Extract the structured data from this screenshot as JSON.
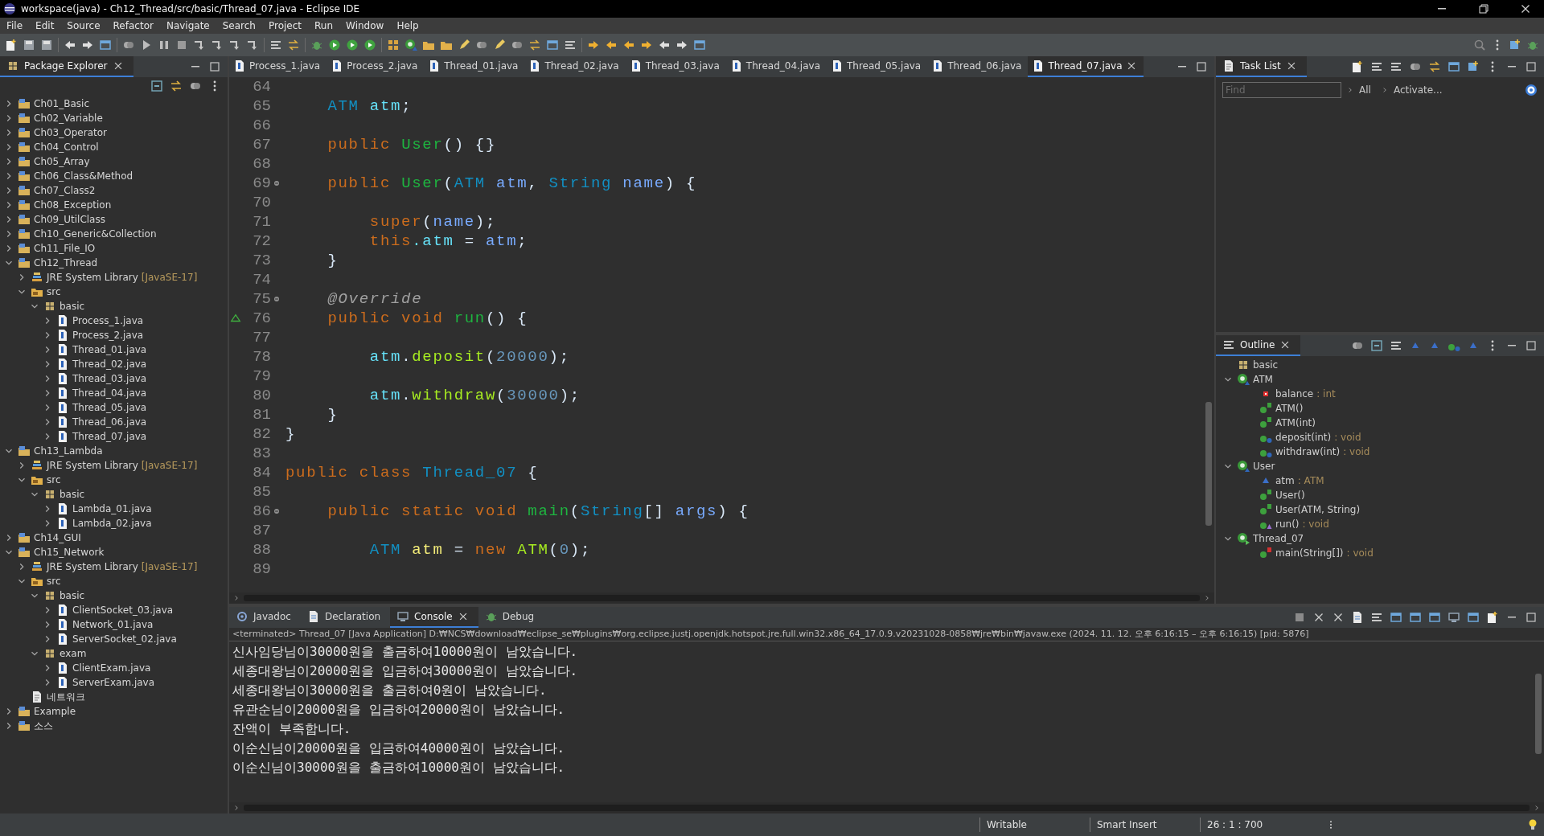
{
  "window": {
    "title": "workspace(java) - Ch12_Thread/src/basic/Thread_07.java - Eclipse IDE"
  },
  "menu": [
    "File",
    "Edit",
    "Source",
    "Refactor",
    "Navigate",
    "Search",
    "Project",
    "Run",
    "Window",
    "Help"
  ],
  "package_explorer": {
    "title": "Package Explorer",
    "tree": [
      {
        "label": "Ch01_Basic",
        "kind": "project",
        "expanded": false
      },
      {
        "label": "Ch02_Variable",
        "kind": "project",
        "expanded": false
      },
      {
        "label": "Ch03_Operator",
        "kind": "project",
        "expanded": false
      },
      {
        "label": "Ch04_Control",
        "kind": "project",
        "expanded": false
      },
      {
        "label": "Ch05_Array",
        "kind": "project",
        "expanded": false
      },
      {
        "label": "Ch06_Class&Method",
        "kind": "project",
        "expanded": false
      },
      {
        "label": "Ch07_Class2",
        "kind": "project",
        "expanded": false
      },
      {
        "label": "Ch08_Exception",
        "kind": "project",
        "expanded": false
      },
      {
        "label": "Ch09_UtilClass",
        "kind": "project",
        "expanded": false
      },
      {
        "label": "Ch10_Generic&Collection",
        "kind": "project",
        "expanded": false
      },
      {
        "label": "Ch11_File_IO",
        "kind": "project",
        "expanded": false
      },
      {
        "label": "Ch12_Thread",
        "kind": "project",
        "expanded": true,
        "children": [
          {
            "label": "JRE System Library",
            "decoration": "[JavaSE-17]",
            "kind": "library",
            "expanded": false
          },
          {
            "label": "src",
            "kind": "source-folder",
            "expanded": true,
            "children": [
              {
                "label": "basic",
                "kind": "package",
                "expanded": true,
                "children": [
                  {
                    "label": "Process_1.java",
                    "kind": "java-file",
                    "expanded": false
                  },
                  {
                    "label": "Process_2.java",
                    "kind": "java-file",
                    "expanded": false
                  },
                  {
                    "label": "Thread_01.java",
                    "kind": "java-file",
                    "expanded": false
                  },
                  {
                    "label": "Thread_02.java",
                    "kind": "java-file",
                    "expanded": false
                  },
                  {
                    "label": "Thread_03.java",
                    "kind": "java-file",
                    "expanded": false
                  },
                  {
                    "label": "Thread_04.java",
                    "kind": "java-file",
                    "expanded": false
                  },
                  {
                    "label": "Thread_05.java",
                    "kind": "java-file",
                    "expanded": false
                  },
                  {
                    "label": "Thread_06.java",
                    "kind": "java-file",
                    "expanded": false
                  },
                  {
                    "label": "Thread_07.java",
                    "kind": "java-file",
                    "expanded": false
                  }
                ]
              }
            ]
          }
        ]
      },
      {
        "label": "Ch13_Lambda",
        "kind": "project",
        "expanded": true,
        "children": [
          {
            "label": "JRE System Library",
            "decoration": "[JavaSE-17]",
            "kind": "library",
            "expanded": false
          },
          {
            "label": "src",
            "kind": "source-folder",
            "expanded": true,
            "children": [
              {
                "label": "basic",
                "kind": "package",
                "expanded": true,
                "children": [
                  {
                    "label": "Lambda_01.java",
                    "kind": "java-file",
                    "expanded": false
                  },
                  {
                    "label": "Lambda_02.java",
                    "kind": "java-file",
                    "expanded": false
                  }
                ]
              }
            ]
          }
        ]
      },
      {
        "label": "Ch14_GUI",
        "kind": "project",
        "expanded": false
      },
      {
        "label": "Ch15_Network",
        "kind": "project",
        "expanded": true,
        "children": [
          {
            "label": "JRE System Library",
            "decoration": "[JavaSE-17]",
            "kind": "library",
            "expanded": false
          },
          {
            "label": "src",
            "kind": "source-folder",
            "expanded": true,
            "children": [
              {
                "label": "basic",
                "kind": "package",
                "expanded": true,
                "children": [
                  {
                    "label": "ClientSocket_03.java",
                    "kind": "java-file",
                    "expanded": false
                  },
                  {
                    "label": "Network_01.java",
                    "kind": "java-file",
                    "expanded": false
                  },
                  {
                    "label": "ServerSocket_02.java",
                    "kind": "java-file",
                    "expanded": false
                  }
                ]
              },
              {
                "label": "exam",
                "kind": "package",
                "expanded": true,
                "children": [
                  {
                    "label": "ClientExam.java",
                    "kind": "java-file",
                    "expanded": false
                  },
                  {
                    "label": "ServerExam.java",
                    "kind": "java-file",
                    "expanded": false
                  }
                ]
              }
            ]
          },
          {
            "label": "네트워크",
            "kind": "text-file"
          }
        ]
      },
      {
        "label": "Example",
        "kind": "project",
        "expanded": false
      },
      {
        "label": "소스",
        "kind": "project",
        "expanded": false
      }
    ]
  },
  "editor": {
    "tabs": [
      {
        "label": "Process_1.java",
        "selected": false
      },
      {
        "label": "Process_2.java",
        "selected": false
      },
      {
        "label": "Thread_01.java",
        "selected": false
      },
      {
        "label": "Thread_02.java",
        "selected": false
      },
      {
        "label": "Thread_03.java",
        "selected": false
      },
      {
        "label": "Thread_04.java",
        "selected": false
      },
      {
        "label": "Thread_05.java",
        "selected": false
      },
      {
        "label": "Thread_06.java",
        "selected": false
      },
      {
        "label": "Thread_07.java",
        "selected": true
      }
    ],
    "lines": [
      {
        "number": "64",
        "fold": false,
        "override": false
      },
      {
        "number": "65",
        "fold": false,
        "override": false,
        "tokens": [
          {
            "text": "    ATM",
            "kind": "type"
          },
          {
            "text": " atm",
            "kind": "field"
          },
          {
            "text": ";",
            "kind": "plain"
          }
        ]
      },
      {
        "number": "66",
        "fold": false,
        "override": false
      },
      {
        "number": "67",
        "fold": false,
        "override": false,
        "tokens": [
          {
            "text": "    public ",
            "kind": "keyword"
          },
          {
            "text": "User",
            "kind": "declaration"
          },
          {
            "text": "() {}",
            "kind": "plain"
          }
        ]
      },
      {
        "number": "68",
        "fold": false,
        "override": false
      },
      {
        "number": "69",
        "fold": true,
        "override": false,
        "tokens": [
          {
            "text": "    public ",
            "kind": "keyword"
          },
          {
            "text": "User",
            "kind": "declaration"
          },
          {
            "text": "(",
            "kind": "plain"
          },
          {
            "text": "ATM",
            "kind": "type"
          },
          {
            "text": " atm",
            "kind": "param"
          },
          {
            "text": ", ",
            "kind": "plain"
          },
          {
            "text": "String",
            "kind": "type"
          },
          {
            "text": " name",
            "kind": "param"
          },
          {
            "text": ") {",
            "kind": "plain"
          }
        ]
      },
      {
        "number": "70",
        "fold": false,
        "override": false
      },
      {
        "number": "71",
        "fold": false,
        "override": false,
        "tokens": [
          {
            "text": "        super",
            "kind": "keyword"
          },
          {
            "text": "(",
            "kind": "plain"
          },
          {
            "text": "name",
            "kind": "param"
          },
          {
            "text": ");",
            "kind": "plain"
          }
        ]
      },
      {
        "number": "72",
        "fold": false,
        "override": false,
        "tokens": [
          {
            "text": "        this",
            "kind": "keyword"
          },
          {
            "text": ".atm",
            "kind": "field"
          },
          {
            "text": " = ",
            "kind": "plain"
          },
          {
            "text": "atm",
            "kind": "param"
          },
          {
            "text": ";",
            "kind": "plain"
          }
        ]
      },
      {
        "number": "73",
        "fold": false,
        "override": false,
        "tokens": [
          {
            "text": "    }",
            "kind": "plain"
          }
        ]
      },
      {
        "number": "74",
        "fold": false,
        "override": false
      },
      {
        "number": "75",
        "fold": true,
        "override": false,
        "tokens": [
          {
            "text": "    @Override",
            "kind": "annotation"
          }
        ]
      },
      {
        "number": "76",
        "fold": false,
        "override": true,
        "tokens": [
          {
            "text": "    public void ",
            "kind": "keyword"
          },
          {
            "text": "run",
            "kind": "declaration"
          },
          {
            "text": "() {",
            "kind": "plain"
          }
        ]
      },
      {
        "number": "77",
        "fold": false,
        "override": false
      },
      {
        "number": "78",
        "fold": false,
        "override": false,
        "tokens": [
          {
            "text": "        atm",
            "kind": "field"
          },
          {
            "text": ".",
            "kind": "plain"
          },
          {
            "text": "deposit",
            "kind": "call"
          },
          {
            "text": "(",
            "kind": "plain"
          },
          {
            "text": "20000",
            "kind": "number"
          },
          {
            "text": ");",
            "kind": "plain"
          }
        ]
      },
      {
        "number": "79",
        "fold": false,
        "override": false
      },
      {
        "number": "80",
        "fold": false,
        "override": false,
        "tokens": [
          {
            "text": "        atm",
            "kind": "field"
          },
          {
            "text": ".",
            "kind": "plain"
          },
          {
            "text": "withdraw",
            "kind": "call"
          },
          {
            "text": "(",
            "kind": "plain"
          },
          {
            "text": "30000",
            "kind": "number"
          },
          {
            "text": ");",
            "kind": "plain"
          }
        ]
      },
      {
        "number": "81",
        "fold": false,
        "override": false,
        "tokens": [
          {
            "text": "    }",
            "kind": "plain"
          }
        ]
      },
      {
        "number": "82",
        "fold": false,
        "override": false,
        "tokens": [
          {
            "text": "}",
            "kind": "plain"
          }
        ]
      },
      {
        "number": "83",
        "fold": false,
        "override": false
      },
      {
        "number": "84",
        "fold": false,
        "override": false,
        "tokens": [
          {
            "text": "public class ",
            "kind": "keyword"
          },
          {
            "text": "Thread_07",
            "kind": "type"
          },
          {
            "text": " {",
            "kind": "plain"
          }
        ]
      },
      {
        "number": "85",
        "fold": false,
        "override": false
      },
      {
        "number": "86",
        "fold": true,
        "override": false,
        "tokens": [
          {
            "text": "    public static void ",
            "kind": "keyword"
          },
          {
            "text": "main",
            "kind": "declaration"
          },
          {
            "text": "(",
            "kind": "plain"
          },
          {
            "text": "String",
            "kind": "type"
          },
          {
            "text": "[] ",
            "kind": "plain"
          },
          {
            "text": "args",
            "kind": "param"
          },
          {
            "text": ") {",
            "kind": "plain"
          }
        ]
      },
      {
        "number": "87",
        "fold": false,
        "override": false
      },
      {
        "number": "88",
        "fold": false,
        "override": false,
        "tokens": [
          {
            "text": "        ATM",
            "kind": "type"
          },
          {
            "text": " atm",
            "kind": "local"
          },
          {
            "text": " = ",
            "kind": "plain"
          },
          {
            "text": "new ",
            "kind": "keyword"
          },
          {
            "text": "ATM",
            "kind": "call"
          },
          {
            "text": "(",
            "kind": "plain"
          },
          {
            "text": "0",
            "kind": "number"
          },
          {
            "text": ");",
            "kind": "plain"
          }
        ]
      },
      {
        "number": "89",
        "fold": false,
        "override": false
      }
    ]
  },
  "task_list": {
    "title": "Task List",
    "find": {
      "placeholder": "Find"
    },
    "links": [
      "All",
      "Activate..."
    ]
  },
  "outline": {
    "title": "Outline",
    "tree": [
      {
        "label": "basic",
        "kind": "package"
      },
      {
        "label": "ATM",
        "kind": "class",
        "expanded": true,
        "children": [
          {
            "label": "balance",
            "detail": ": int",
            "kind": "private-field"
          },
          {
            "label": "ATM()",
            "kind": "constructor"
          },
          {
            "label": "ATM(int)",
            "kind": "constructor"
          },
          {
            "label": "deposit(int)",
            "detail": ": void",
            "kind": "method"
          },
          {
            "label": "withdraw(int)",
            "detail": ": void",
            "kind": "method"
          }
        ]
      },
      {
        "label": "User",
        "kind": "class",
        "expanded": true,
        "children": [
          {
            "label": "atm",
            "detail": ": ATM",
            "kind": "default-field"
          },
          {
            "label": "User()",
            "kind": "constructor"
          },
          {
            "label": "User(ATM, String)",
            "kind": "constructor"
          },
          {
            "label": "run()",
            "detail": ": void",
            "kind": "override-method"
          }
        ]
      },
      {
        "label": "Thread_07",
        "kind": "main-class",
        "expanded": true,
        "children": [
          {
            "label": "main(String[])",
            "detail": ": void",
            "kind": "static-method"
          }
        ]
      }
    ]
  },
  "console": {
    "tabs": [
      {
        "label": "Javadoc",
        "selected": false
      },
      {
        "label": "Declaration",
        "selected": false
      },
      {
        "label": "Console",
        "selected": true
      },
      {
        "label": "Debug",
        "selected": false
      }
    ],
    "header": "<terminated> Thread_07 [Java Application] D:₩NCS₩download₩eclipse_se₩plugins₩org.eclipse.justj.openjdk.hotspot.jre.full.win32.x86_64_17.0.9.v20231028-0858₩jre₩bin₩javaw.exe  (2024. 11. 12. 오후 6:16:15 – 오후 6:16:15) [pid: 5876]",
    "output": [
      "신사임당님이30000원을 출금하여10000원이 남았습니다.",
      "세종대왕님이20000원을 입금하여30000원이 남았습니다.",
      "세종대왕님이30000원을 출금하여0원이 남았습니다.",
      "유관순님이20000원을 입금하여20000원이 남았습니다.",
      "잔액이 부족합니다.",
      "이순신님이20000원을 입금하여40000원이 남았습니다.",
      "이순신님이30000원을 출금하여10000원이 남았습니다."
    ]
  },
  "status_bar": {
    "fields": [
      "Writable",
      "Smart Insert",
      "26 : 1 : 700"
    ]
  }
}
